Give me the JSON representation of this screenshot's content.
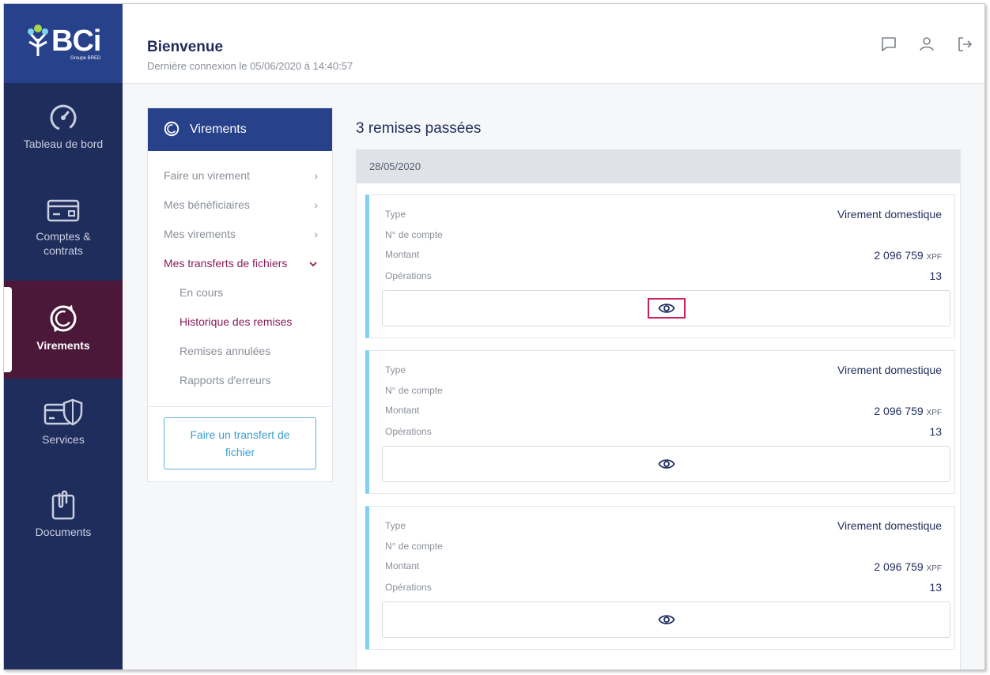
{
  "brand": {
    "logo_text": "BCi",
    "logo_subtitle": "Groupe BRED"
  },
  "sidebar": {
    "items": [
      {
        "label": "Tableau de bord",
        "icon": "gauge-icon"
      },
      {
        "label": "Comptes & contrats",
        "icon": "card-icon"
      },
      {
        "label": "Virements",
        "icon": "transfer-icon",
        "active": true
      },
      {
        "label": "Services",
        "icon": "shield-card-icon"
      },
      {
        "label": "Documents",
        "icon": "clipboard-icon"
      }
    ]
  },
  "header": {
    "title": "Bienvenue",
    "last_login": "Dernière connexion le 05/06/2020 à 14:40:57",
    "icons": [
      "message-icon",
      "user-icon",
      "logout-icon"
    ]
  },
  "submenu": {
    "title": "Virements",
    "items": [
      {
        "label": "Faire un virement"
      },
      {
        "label": "Mes bénéficiaires"
      },
      {
        "label": "Mes virements"
      },
      {
        "label": "Mes transferts de fichiers",
        "open": true
      }
    ],
    "subitems": [
      {
        "label": "En cours"
      },
      {
        "label": "Historique des remises",
        "active": true
      },
      {
        "label": "Remises annulées"
      },
      {
        "label": "Rapports d'erreurs"
      }
    ],
    "button_label": "Faire un transfert de fichier"
  },
  "main": {
    "title": "3 remises passées",
    "group_date": "28/05/2020",
    "cards": [
      {
        "type_label": "Type",
        "type_value": "Virement domestique",
        "account_label": "N° de compte",
        "amount_label": "Montant",
        "amount_value": "2 096 759",
        "currency": "XPF",
        "ops_label": "Opérations",
        "ops_value": "13"
      },
      {
        "type_label": "Type",
        "type_value": "Virement domestique",
        "account_label": "N° de compte",
        "amount_label": "Montant",
        "amount_value": "2 096 759",
        "currency": "XPF",
        "ops_label": "Opérations",
        "ops_value": "13"
      },
      {
        "type_label": "Type",
        "type_value": "Virement domestique",
        "account_label": "N° de compte",
        "amount_label": "Montant",
        "amount_value": "2 096 759",
        "currency": "XPF",
        "ops_label": "Opérations",
        "ops_value": "13"
      }
    ]
  },
  "colors": {
    "sidebar": "#1f2d5c",
    "brand_blue": "#27418a",
    "active_purple": "#4c1839",
    "accent_magenta": "#8a1d5c",
    "card_accent": "#7fd1f0",
    "highlight": "#cc1f5c"
  }
}
